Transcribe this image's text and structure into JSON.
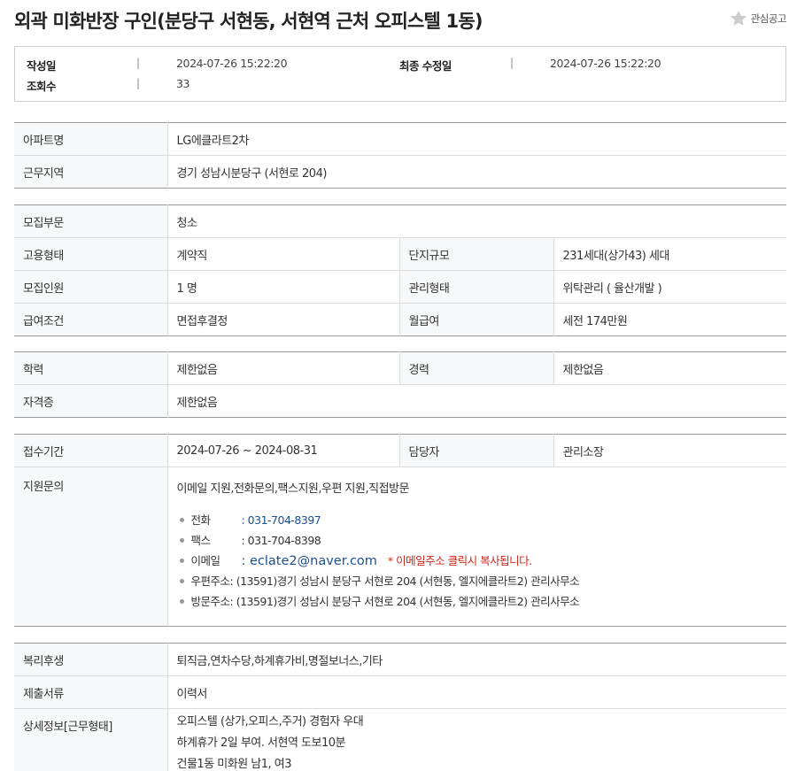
{
  "page": {
    "title": "외곽 미화반장 구인(분당구 서현동, 서현역 근처 오피스텔 1동)",
    "favorite_label": "관심공고"
  },
  "meta": {
    "created_label": "작성일",
    "created_value": "2024-07-26 15:22:20",
    "modified_label": "최종 수정일",
    "modified_value": "2024-07-26 15:22:20",
    "views_label": "조회수",
    "views_value": "33",
    "separator": "|"
  },
  "apartment": {
    "name_label": "아파트명",
    "name_value": "LG에클라트2차",
    "area_label": "근무지역",
    "area_value": "경기  성남시분당구 (서현로 204)"
  },
  "recruit": {
    "dept_label": "모집부문",
    "dept_value": "청소",
    "employ_label": "고용형태",
    "employ_value": "계약직",
    "scale_label": "단지규모",
    "scale_value": "231세대(상가43) 세대",
    "count_label": "모집인원",
    "count_value": "1 명",
    "manage_label": "관리형태",
    "manage_value": "위탁관리 ( 율산개발 )",
    "pay_label": "급여조건",
    "pay_value": "면접후결정",
    "monthly_label": "월급여",
    "monthly_value": "세전 174만원"
  },
  "qualification": {
    "edu_label": "학력",
    "edu_value": "제한없음",
    "career_label": "경력",
    "career_value": "제한없음",
    "cert_label": "자격증",
    "cert_value": "제한없음"
  },
  "application": {
    "period_label": "접수기간",
    "period_value": "2024-07-26 ~ 2024-08-31",
    "manager_label": "담당자",
    "manager_value": "관리소장",
    "inquiry_label": "지원문의",
    "inquiry_methods": "이메일 지원,전화문의,팩스지원,우편 지원,직접방문",
    "phone_label": "전화",
    "phone_value": ": 031-704-8397",
    "fax_label": "팩스",
    "fax_value": ": 031-704-8398",
    "email_label": "이메일",
    "email_value": ": eclate2@naver.com",
    "email_note": "* 이메일주소 클릭시 복사됩니다.",
    "post_label": "우편주소",
    "post_value": ": (13591)경기 성남시 분당구 서현로 204 (서현동, 엘지에클라트2) 관리사무소",
    "visit_label": "방문주소",
    "visit_value": ": (13591)경기 성남시 분당구 서현로 204 (서현동, 엘지에클라트2) 관리사무소"
  },
  "extra": {
    "welfare_label": "복리후생",
    "welfare_value": "퇴직금,연차수당,하계휴가비,명절보너스,기타",
    "docs_label": "제출서류",
    "docs_value": "이력서",
    "detail_label": "상세정보[근무형태]",
    "detail_lines": [
      "오피스텔 (상가,오피스,주거) 경험자 우대",
      "하계휴가 2일 부여. 서현역 도보10분",
      "건물1동 미화원 남1, 여3"
    ]
  },
  "colors": {
    "link": "#1d4f91",
    "notice_red": "#d0271d",
    "header_bg": "#f7f8fa",
    "star": "#cccccc"
  }
}
